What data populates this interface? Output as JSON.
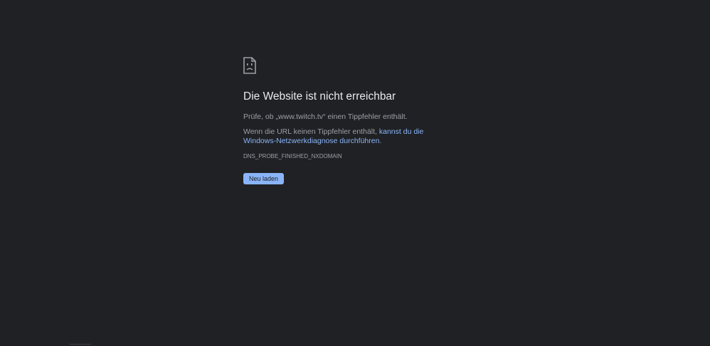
{
  "error_page": {
    "title": "Die Website ist nicht erreichbar",
    "check_text": "Prüfe, ob „www.twitch.tv“ einen Tippfehler enthält.",
    "diagnose_prefix": "Wenn die URL keinen Tippfehler enthält, ",
    "diagnose_link": "kannst du die Windows-Netzwerkdiagnose durchführen",
    "diagnose_suffix": ".",
    "error_code": "DNS_PROBE_FINISHED_NXDOMAIN",
    "reload_label": "Neu laden",
    "icon": "sad-document-icon"
  },
  "colors": {
    "background": "#202124",
    "title": "#e8eaed",
    "text": "#9aa0a6",
    "link": "#8ab4f8",
    "button": "#8ab4f8"
  }
}
